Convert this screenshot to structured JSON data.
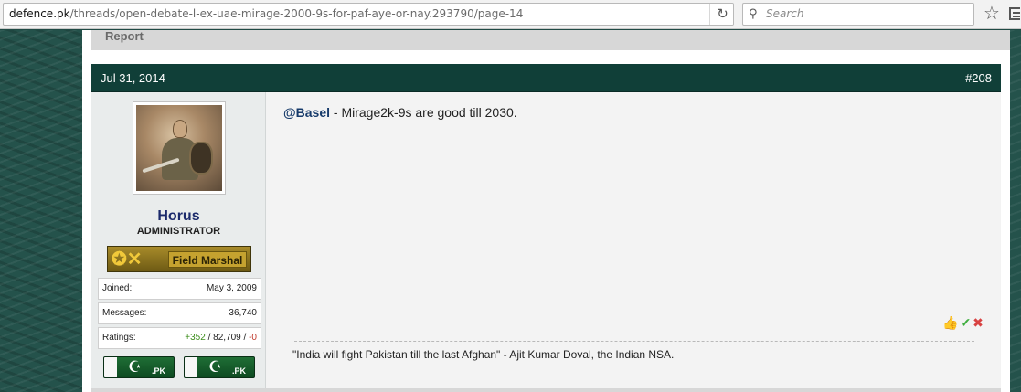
{
  "browser": {
    "url_domain": "defence.pk",
    "url_path": "/threads/open-debate-l-ex-uae-mirage-2000-9s-for-paf-aye-or-nay.293790/page-14",
    "search_placeholder": "Search"
  },
  "previous_post": {
    "report_label": "Report"
  },
  "post": {
    "date": "Jul 31, 2014",
    "number": "#208",
    "user": {
      "name": "Horus",
      "title": "ADMINISTRATOR",
      "rank": "Field Marshal",
      "stats": [
        {
          "label": "Joined:",
          "value": "May 3, 2009"
        },
        {
          "label": "Messages:",
          "value": "36,740"
        }
      ],
      "ratings": {
        "label": "Ratings:",
        "positive": "+352",
        "separator1": " / ",
        "neutral": "82,709",
        "separator2": " / ",
        "negative": "-0"
      },
      "flag_labels": [
        ".PK",
        ".PK"
      ]
    },
    "message": {
      "mention": "@Basel",
      "text": " - Mirage2k-9s are good till 2030."
    },
    "signature": "\"India will fight Pakistan till the last Afghan\" - Ajit Kumar Doval, the Indian NSA."
  }
}
